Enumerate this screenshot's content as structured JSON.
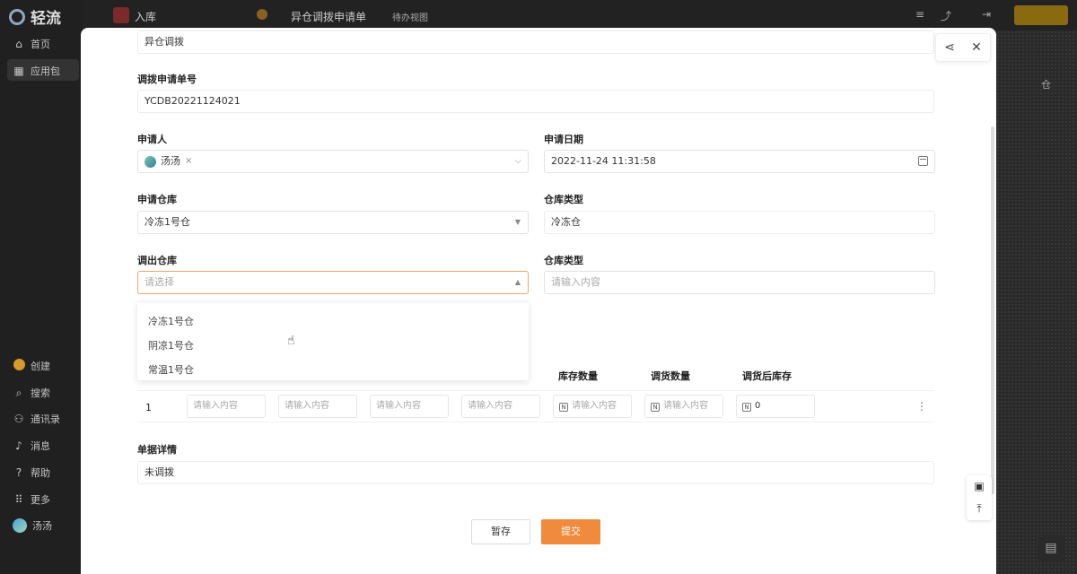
{
  "app": {
    "logo_text": "轻流",
    "nav": [
      {
        "label": "首页",
        "icon": "home-icon",
        "glyph": "⌂"
      },
      {
        "label": "应用包",
        "icon": "apps-icon",
        "glyph": "▦"
      }
    ],
    "nav_bottom": [
      {
        "label": "创建",
        "icon": "create-icon"
      },
      {
        "label": "搜索",
        "icon": "search-icon",
        "glyph": "⌕"
      },
      {
        "label": "通讯录",
        "icon": "contacts-icon",
        "glyph": "⚇"
      },
      {
        "label": "消息",
        "icon": "bell-icon",
        "glyph": "♪"
      },
      {
        "label": "帮助",
        "icon": "help-icon",
        "glyph": "?"
      },
      {
        "label": "更多",
        "icon": "grid-icon",
        "glyph": "⠿"
      },
      {
        "label": "汤汤",
        "icon": "user-avatar"
      }
    ],
    "top_app_name": "入库",
    "top_form_name": "异仓调拨申请单",
    "top_view": "待办视图",
    "right_side_text": "仓"
  },
  "form": {
    "first_value": "异仓调拨",
    "order_no": {
      "label": "调拨申请单号",
      "value": "YCDB20221124021"
    },
    "applicant": {
      "label": "申请人",
      "value": "汤汤"
    },
    "apply_date": {
      "label": "申请日期",
      "value": "2022-11-24 11:31:58"
    },
    "apply_warehouse": {
      "label": "申请仓库",
      "value": "冷冻1号仓"
    },
    "warehouse_type_1": {
      "label": "仓库类型",
      "value": "冷冻仓"
    },
    "out_warehouse": {
      "label": "调出仓库",
      "placeholder": "请选择"
    },
    "warehouse_type_2": {
      "label": "仓库类型",
      "placeholder": "请输入内容"
    },
    "dropdown_options": [
      "冷冻1号仓",
      "阴凉1号仓",
      "常温1号仓"
    ],
    "table": {
      "headers": [
        "库存数量",
        "调货数量",
        "调货后库存"
      ],
      "row_index": "1",
      "input_placeholder": "请输入内容",
      "after_stock_value": "0"
    },
    "details": {
      "label": "单据详情",
      "value": "未调拨"
    }
  },
  "footer": {
    "save_label": "暂存",
    "submit_label": "提交"
  },
  "colors": {
    "accent": "#f08a3c",
    "focus_border": "#f2a374"
  }
}
